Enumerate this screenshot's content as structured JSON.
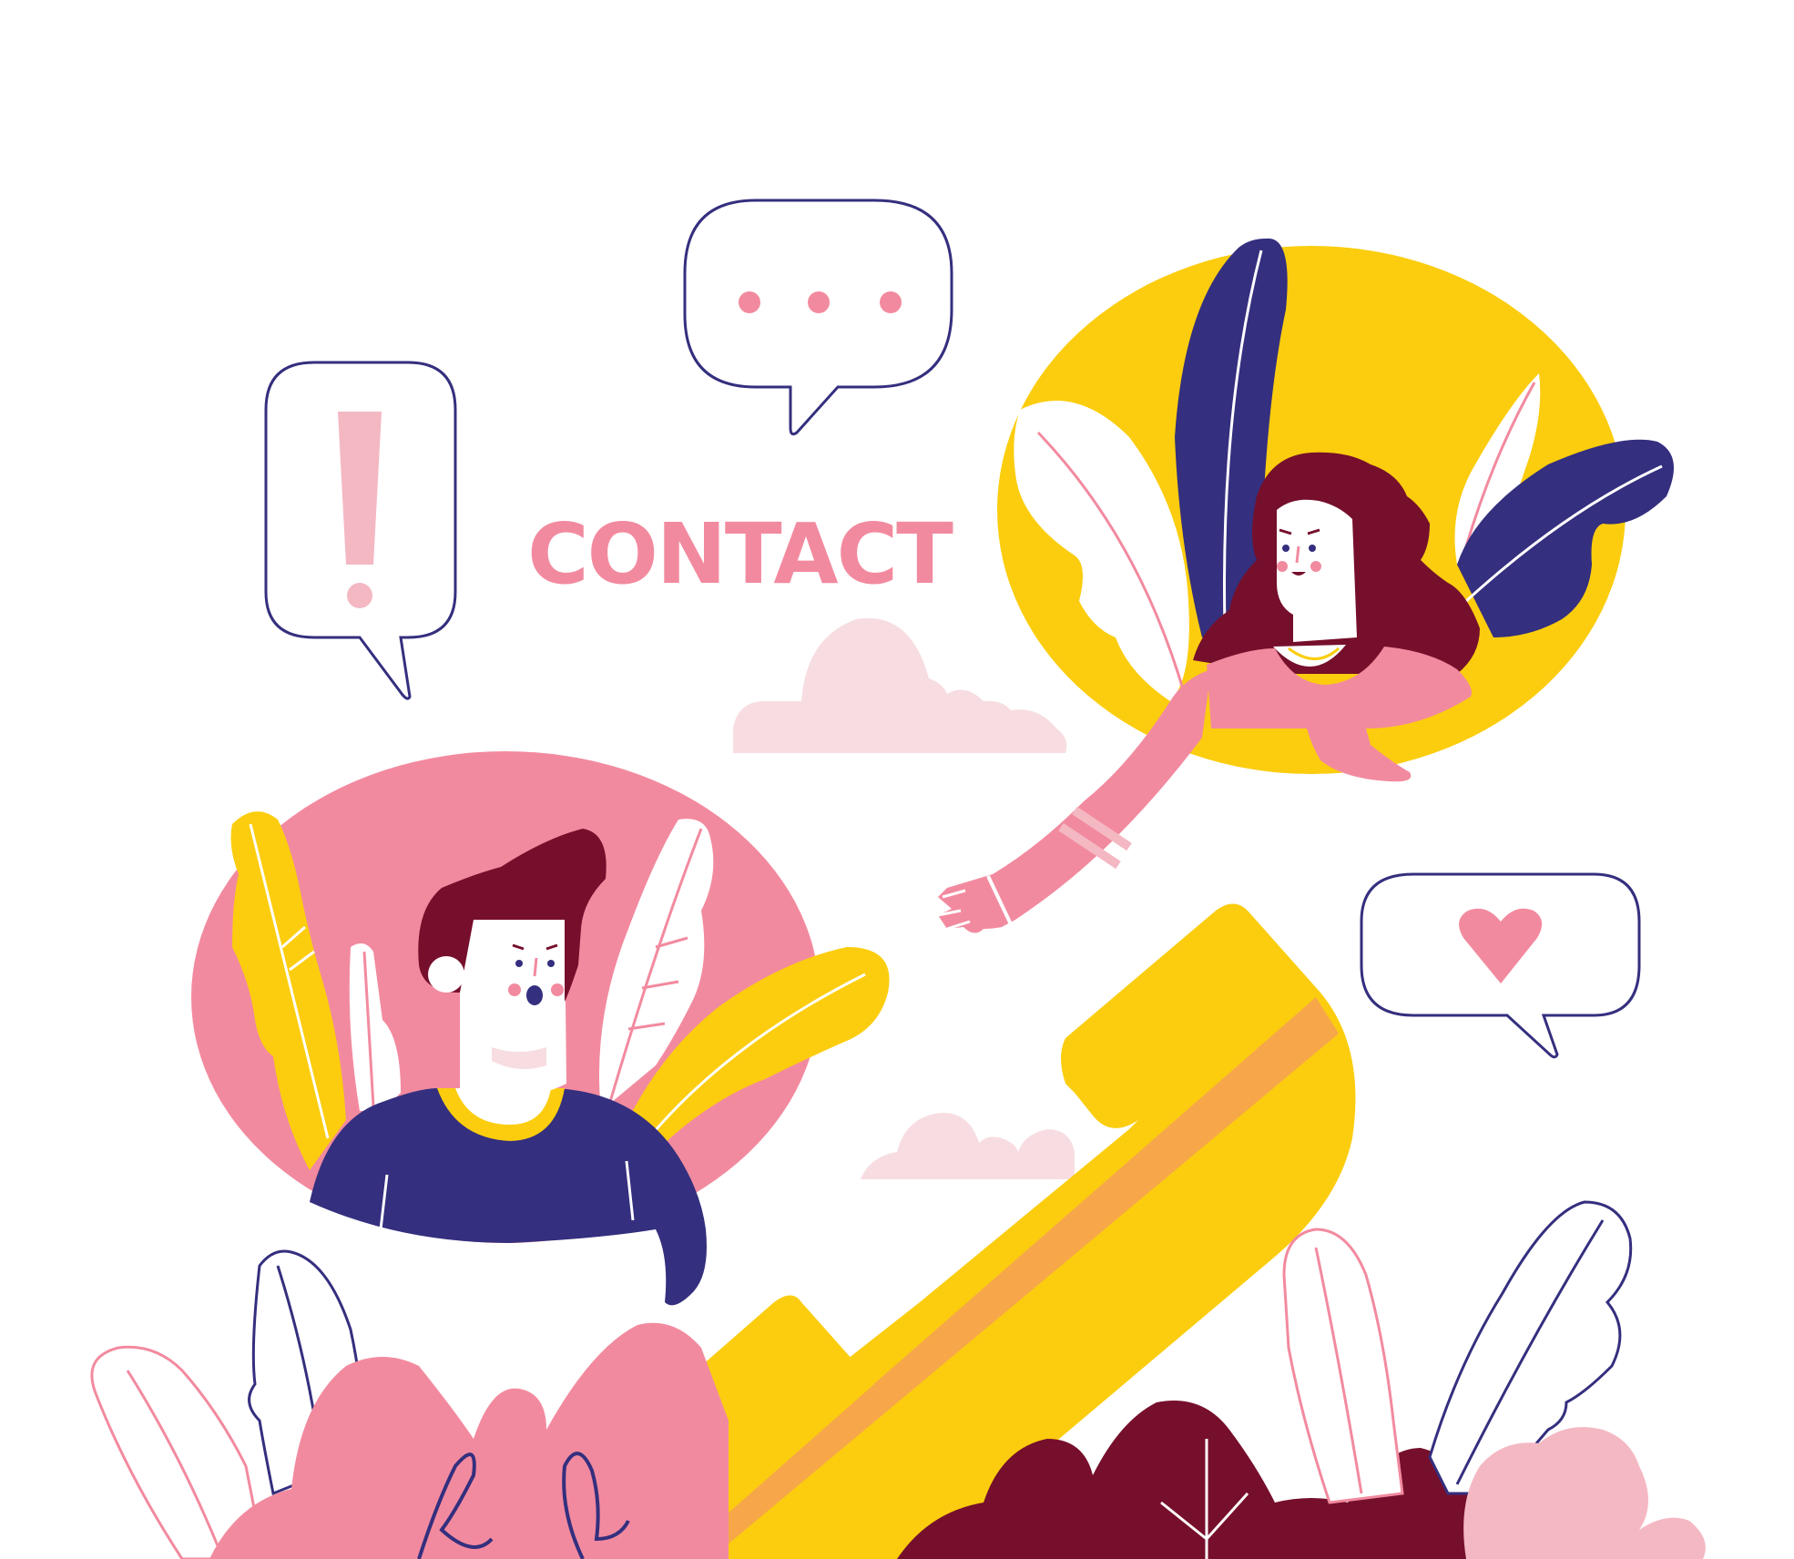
{
  "title": "CONTACT",
  "colors": {
    "pink": "#f28a9f",
    "light_pink": "#f4b8c3",
    "pale_pink": "#f7dde1",
    "yellow": "#fbcd0e",
    "orange": "#f7a74a",
    "navy": "#342f7e",
    "maroon": "#760f2c",
    "white": "#ffffff"
  },
  "icons": {
    "speech_bubble_alert": "exclamation-icon",
    "speech_bubble_typing": "ellipsis-icon",
    "speech_bubble_love": "heart-icon",
    "phone": "phone-handset-icon"
  }
}
